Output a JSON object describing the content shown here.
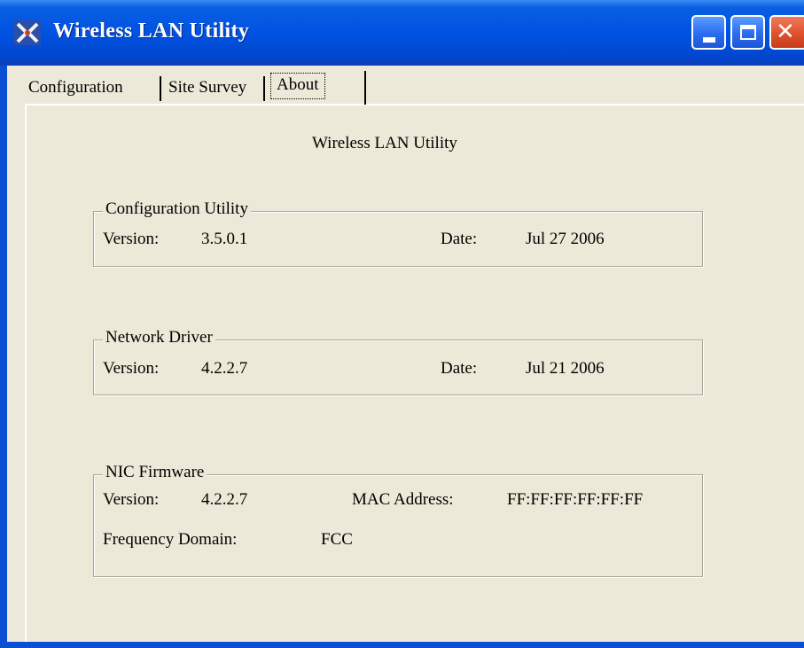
{
  "window": {
    "title": "Wireless LAN Utility",
    "icon": "wireless-utility-icon",
    "controls": {
      "minimize": "minimize-icon",
      "maximize": "maximize-icon",
      "close": "close-icon",
      "close_glyph": "✕"
    }
  },
  "tabs": [
    {
      "label": "Configuration"
    },
    {
      "label": "Site Survey"
    },
    {
      "label": "About",
      "active": true
    }
  ],
  "about": {
    "heading": "Wireless LAN Utility",
    "config_utility": {
      "title": "Configuration Utility",
      "version_label": "Version:",
      "version": "3.5.0.1",
      "date_label": "Date:",
      "date": "Jul 27 2006"
    },
    "network_driver": {
      "title": "Network Driver",
      "version_label": "Version:",
      "version": "4.2.2.7",
      "date_label": "Date:",
      "date": "Jul 21 2006"
    },
    "nic_firmware": {
      "title": "NIC Firmware",
      "version_label": "Version:",
      "version": "4.2.2.7",
      "mac_label": "MAC Address:",
      "mac": "FF:FF:FF:FF:FF:FF",
      "freq_label": "Frequency Domain:",
      "freq": "FCC"
    }
  },
  "colors": {
    "titlebar": "#0054e3",
    "dialog_bg": "#ece9d8",
    "close_button": "#e0502c"
  }
}
